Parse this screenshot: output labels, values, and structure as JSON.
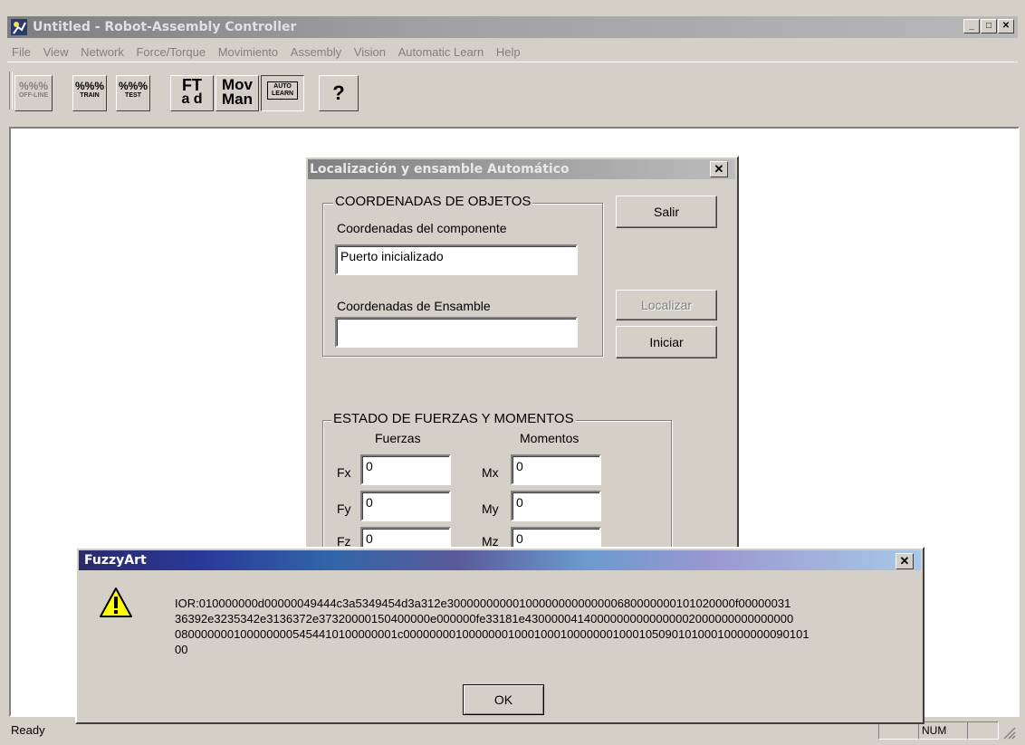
{
  "window": {
    "title": "Untitled - Robot-Assembly Controller"
  },
  "menu": [
    "File",
    "View",
    "Network",
    "Force/Torque",
    "Movimiento",
    "Assembly",
    "Vision",
    "Automatic Learn",
    "Help"
  ],
  "toolbar": {
    "offline": "OFF-LINE",
    "train": "TRAIN",
    "test": "TEST",
    "ft_line1": "FT",
    "ft_line2": "a d",
    "mov_line1": "Mov",
    "mov_line2": "Man",
    "auto_line1": "AUTO",
    "auto_line2": "LEARN",
    "help_glyph": "?"
  },
  "status": {
    "ready": "Ready",
    "num": "NUM"
  },
  "dialog": {
    "title": "Localización y ensamble Automático",
    "group_coords": "COORDENADAS DE OBJETOS",
    "label_component": "Coordenadas del componente",
    "component_value": "Puerto inicializado",
    "label_assembly": "Coordenadas de Ensamble",
    "assembly_value": "",
    "btn_salir": "Salir",
    "btn_localizar": "Localizar",
    "btn_iniciar": "Iniciar",
    "group_forces": "ESTADO DE FUERZAS Y MOMENTOS",
    "col_forces": "Fuerzas",
    "col_moments": "Momentos",
    "fx_label": "Fx",
    "fx_value": "0",
    "fy_label": "Fy",
    "fy_value": "0",
    "fz_label": "Fz",
    "fz_value": "0",
    "mx_label": "Mx",
    "mx_value": "0",
    "my_label": "My",
    "my_value": "0",
    "mz_label": "Mz",
    "mz_value": "0"
  },
  "messagebox": {
    "title": "FuzzyArt",
    "icon": "warning-icon",
    "line1": "IOR:010000000d00000049444c3a5349454d3a312e30000000000100000000000000680000000101020000f00000031",
    "line2": "36392e3235342e3136372e37320000150400000e000000fe33181e43000004140000000000000002000000000000000",
    "line3": "0800000001000000005454410100000001c00000000100000001000100010000000100010509010100010000000090101",
    "line4": "00",
    "ok": "OK"
  }
}
